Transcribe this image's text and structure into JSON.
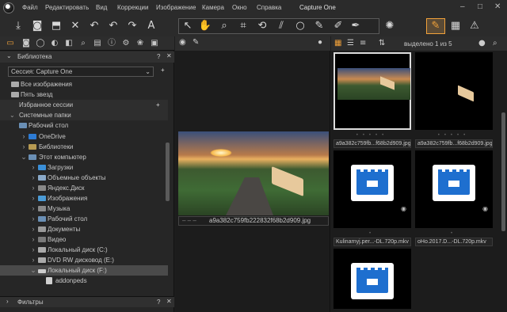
{
  "app": {
    "title": "Capture One"
  },
  "menu": [
    "Файл",
    "Редактировать",
    "Вид",
    "Коррекции",
    "Изображение",
    "Камера",
    "Окно",
    "Справка"
  ],
  "window_controls": [
    "–",
    "□",
    "✕"
  ],
  "library": {
    "title": "Библиотека",
    "help": "?",
    "close": "✕",
    "session_value": "Сессия: Capture One",
    "session_add": "+",
    "collections": [
      "Все изображения",
      "Пять звезд"
    ],
    "favorites_label": "Избранное сессии",
    "favorites_add": "+",
    "system_folders_label": "Системные папки",
    "tree": [
      "Рабочий стол",
      "OneDrive",
      "Библиотеки",
      "Этот компьютер",
      "Загрузки",
      "Объемные объекты",
      "Яндекс.Диск",
      "Изображения",
      "Музыка",
      "Рабочий стол",
      "Документы",
      "Видео",
      "Локальный диск (C:)",
      "DVD RW дисковод (E:)",
      "Локальный диск (F:)",
      "addonpeds"
    ]
  },
  "filters": {
    "title": "Фильтры",
    "help": "?",
    "close": "✕"
  },
  "viewer": {
    "caption_status": "– – –",
    "caption_name": "a9a382c759fb222832f68b2d909.jpg"
  },
  "browser": {
    "selection": "выделено 1 из 5",
    "thumbs": [
      {
        "name": "a9a382c759fb...f68b2d909.jpg"
      },
      {
        "name": "a9a382c759fb...f68b2d909.jpg"
      },
      {
        "name": "Kulinarnyj.per...-DL.720p.mkv"
      },
      {
        "name": "oHo.2017.D...-DL.720p.mkv"
      },
      {
        "name": ""
      }
    ]
  },
  "colors": {
    "accent": "#f2a23a",
    "bg": "#1e1e1e",
    "panel": "#262626"
  }
}
